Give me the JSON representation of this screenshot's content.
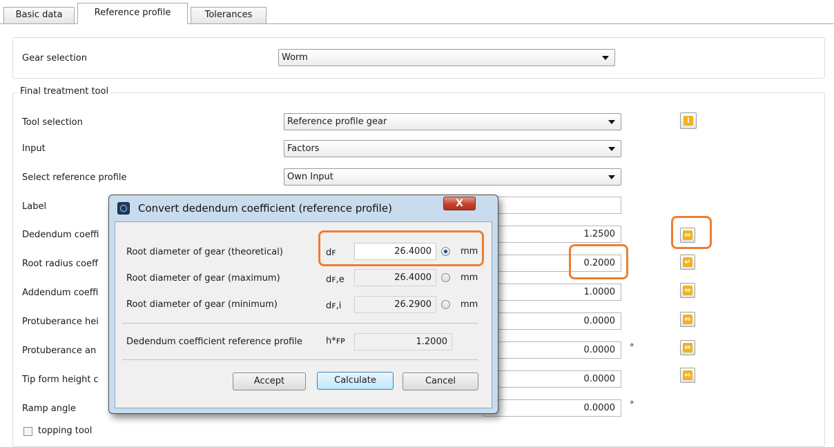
{
  "tabs": [
    {
      "label": "Basic data"
    },
    {
      "label": "Reference profile"
    },
    {
      "label": "Tolerances"
    }
  ],
  "gear_selection": {
    "label": "Gear selection",
    "value": "Worm"
  },
  "final_treatment": {
    "title": "Final treatment tool",
    "tool_selection": {
      "label": "Tool selection",
      "value": "Reference profile gear"
    },
    "input": {
      "label": "Input",
      "value": "Factors"
    },
    "select_reference_profile": {
      "label": "Select reference profile",
      "value": "Own Input"
    },
    "label_field": {
      "label": "Label",
      "value": ""
    },
    "rows": [
      {
        "label": "Dedendum coeffi",
        "value": "1.2500",
        "unit": ""
      },
      {
        "label": "Root radius coeff",
        "value": "0.2000",
        "unit": ""
      },
      {
        "label": "Addendum coeffi",
        "value": "1.0000",
        "unit": ""
      },
      {
        "label": "Protuberance hei",
        "value": "0.0000",
        "unit": ""
      },
      {
        "label": "Protuberance an",
        "value": "0.0000",
        "unit": "°"
      },
      {
        "label": "Tip form height c",
        "value": "0.0000",
        "unit": ""
      },
      {
        "label": "Ramp angle",
        "value": "0.0000",
        "unit": "°"
      }
    ],
    "topping_tool": {
      "label": "topping tool",
      "checked": false
    }
  },
  "side_icons": {
    "info": "i",
    "convert": "⇔",
    "enter": "↵"
  },
  "dialog": {
    "title": "Convert dedendum coefficient (reference profile)",
    "close": "X",
    "rows": [
      {
        "label": "Root diameter of gear (theoretical)",
        "symbol": "dꜰ",
        "value": "26.4000",
        "unit": "mm",
        "selected": true
      },
      {
        "label": "Root diameter of gear (maximum)",
        "symbol": "dꜰ,e",
        "value": "26.4000",
        "unit": "mm",
        "selected": false
      },
      {
        "label": "Root diameter of gear (minimum)",
        "symbol": "dꜰ,i",
        "value": "26.2900",
        "unit": "mm",
        "selected": false
      }
    ],
    "dedendum": {
      "label": "Dedendum coefficient reference profile",
      "symbol": "h*ꜰᴘ",
      "value": "1.2000"
    },
    "buttons": {
      "accept": "Accept",
      "calculate": "Calculate",
      "cancel": "Cancel"
    }
  },
  "colors": {
    "highlight": "#ed7d31",
    "icon": "#f2b21d",
    "dialog_frame": "#c9dcee"
  }
}
